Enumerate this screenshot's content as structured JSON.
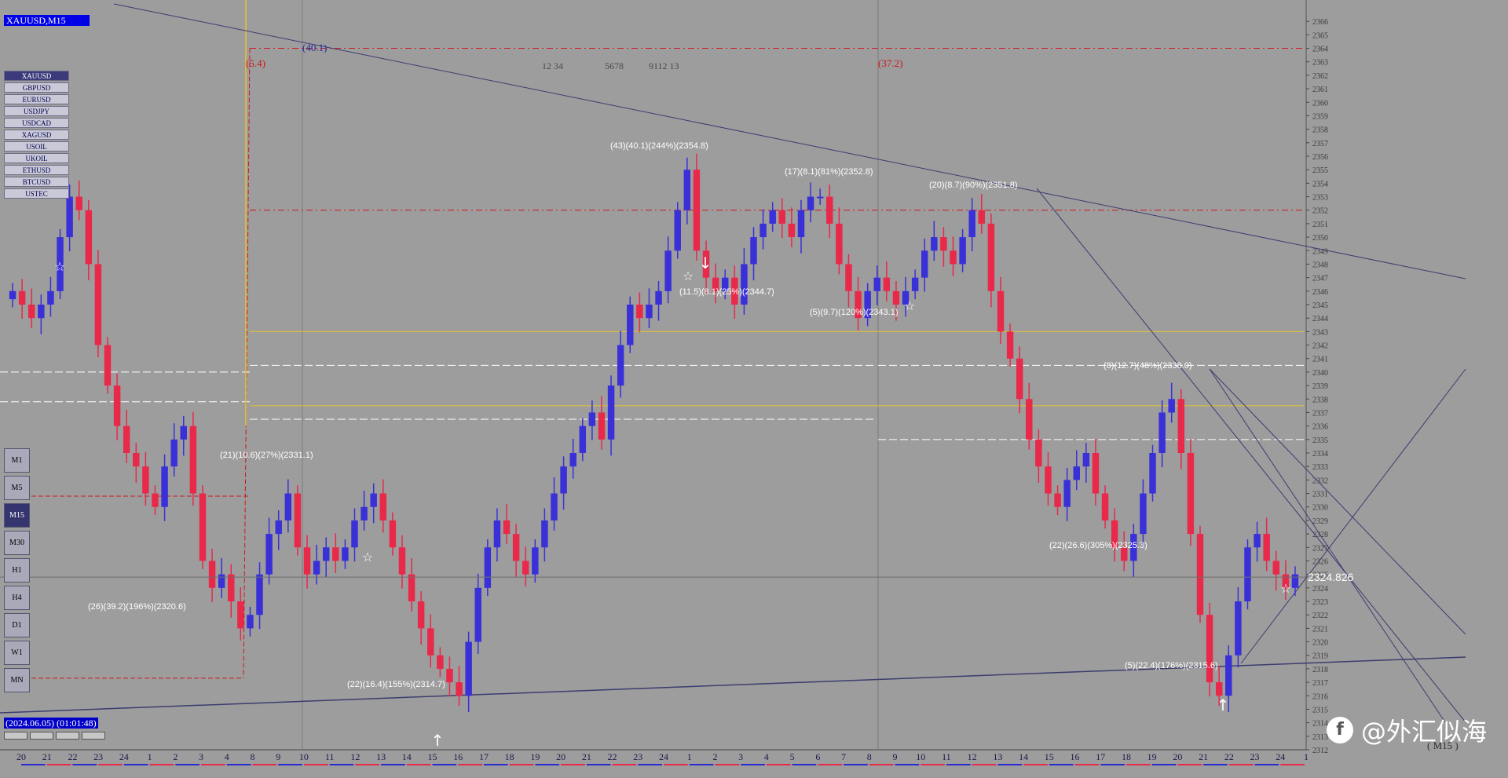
{
  "symbol_title": "XAUUSD,M15",
  "symbols": [
    "XAUUSD",
    "GBPUSD",
    "EURUSD",
    "USDJPY",
    "USDCAD",
    "XAGUSD",
    "USOIL",
    "UKOIL",
    "ETHUSD",
    "BTCUSD",
    "USTEC"
  ],
  "selected_symbol": "XAUUSD",
  "timeframes": [
    "M1",
    "M5",
    "M15",
    "M30",
    "H1",
    "H4",
    "D1",
    "W1",
    "MN"
  ],
  "selected_timeframe": "M15",
  "period_label": "( M15 )",
  "timestamp": "(2024.06.05) (01:01:48)",
  "current_price": "2324.826",
  "watermark": "@外汇似海",
  "colors": {
    "bull": "#3a30d8",
    "bear": "#e8294a",
    "fib_red": "#d0161c",
    "gold": "#e6c230",
    "white_band": "#ffffff",
    "trend": "#3c3c70"
  },
  "chart_data": {
    "type": "candlestick",
    "ylim": [
      2312,
      2367
    ],
    "y_ticks": [
      2312,
      2313,
      2314,
      2315,
      2316,
      2317,
      2318,
      2319,
      2320,
      2321,
      2322,
      2323,
      2324,
      2325,
      2326,
      2327,
      2328,
      2329,
      2330,
      2331,
      2332,
      2333,
      2334,
      2335,
      2336,
      2337,
      2338,
      2339,
      2340,
      2341,
      2342,
      2343,
      2344,
      2345,
      2346,
      2347,
      2348,
      2349,
      2350,
      2351,
      2352,
      2353,
      2354,
      2355,
      2356,
      2357,
      2358,
      2359,
      2360,
      2361,
      2362,
      2363,
      2364,
      2365,
      2366
    ],
    "x_ticks": [
      "20",
      "21",
      "22",
      "23",
      "24",
      "1",
      "2",
      "3",
      "4",
      "8",
      "9",
      "10",
      "11",
      "12",
      "13",
      "14",
      "15",
      "16",
      "17",
      "18",
      "19",
      "20",
      "21",
      "22",
      "23",
      "24",
      "1",
      "2",
      "3",
      "4",
      "5",
      "6",
      "7",
      "8",
      "9",
      "10",
      "11",
      "12",
      "13",
      "14",
      "15",
      "16",
      "17",
      "18",
      "19",
      "20",
      "21",
      "22",
      "23",
      "24",
      "1"
    ],
    "close_path": [
      2346,
      2345,
      2344,
      2345,
      2346,
      2350,
      2353,
      2352,
      2348,
      2342,
      2339,
      2336,
      2334,
      2333,
      2331,
      2330,
      2333,
      2335,
      2336,
      2331,
      2326,
      2324,
      2325,
      2323,
      2321,
      2322,
      2325,
      2328,
      2329,
      2331,
      2327,
      2325,
      2326,
      2327,
      2326,
      2327,
      2329,
      2330,
      2331,
      2329,
      2327,
      2325,
      2323,
      2321,
      2319,
      2318,
      2317,
      2316,
      2320,
      2324,
      2327,
      2329,
      2328,
      2326,
      2325,
      2327,
      2329,
      2331,
      2333,
      2334,
      2336,
      2337,
      2335,
      2339,
      2342,
      2345,
      2344,
      2345,
      2346,
      2349,
      2352,
      2355,
      2349,
      2347,
      2346,
      2347,
      2345,
      2348,
      2350,
      2351,
      2352,
      2351,
      2350,
      2352,
      2353,
      2353,
      2351,
      2348,
      2346,
      2344,
      2346,
      2347,
      2346,
      2345,
      2346,
      2347,
      2349,
      2350,
      2349,
      2348,
      2350,
      2352,
      2351,
      2346,
      2343,
      2341,
      2338,
      2335,
      2333,
      2331,
      2330,
      2332,
      2333,
      2334,
      2331,
      2329,
      2327,
      2326,
      2328,
      2331,
      2334,
      2337,
      2338,
      2334,
      2328,
      2322,
      2317,
      2316,
      2319,
      2323,
      2327,
      2328,
      2326,
      2325,
      2324,
      2325
    ],
    "levels": [
      {
        "label": "(40.1)",
        "price": 2364.0,
        "kind": "fib_red"
      },
      {
        "label": "(5.4)",
        "price": 2352.0,
        "kind": "fib_red"
      },
      {
        "label": "(37.2)",
        "price": 2343.0,
        "kind": "gold"
      }
    ],
    "annotations": [
      "(43)(40.1)(244%)(2354.8)",
      "(17)(8.1)(81%)(2352.8)",
      "(20)(8.7)(90%)(2351.8)",
      "(11.5)(8.1)(25%)(2344.7)",
      "(5)(9.7)(120%)(2343.1)",
      "(8)(12.7)(48%)(2338.0)",
      "(21)(10.6)(27%)(2331.1)",
      "(26)(39.2)(196%)(2320.6)",
      "(22)(16.4)(155%)(2314.7)",
      "(22)(26.6)(305%)(2325.3)",
      "(5)(22.4)(176%)(2315.6)"
    ],
    "top_counts": [
      "12  34",
      "5678",
      "9112  13"
    ]
  }
}
